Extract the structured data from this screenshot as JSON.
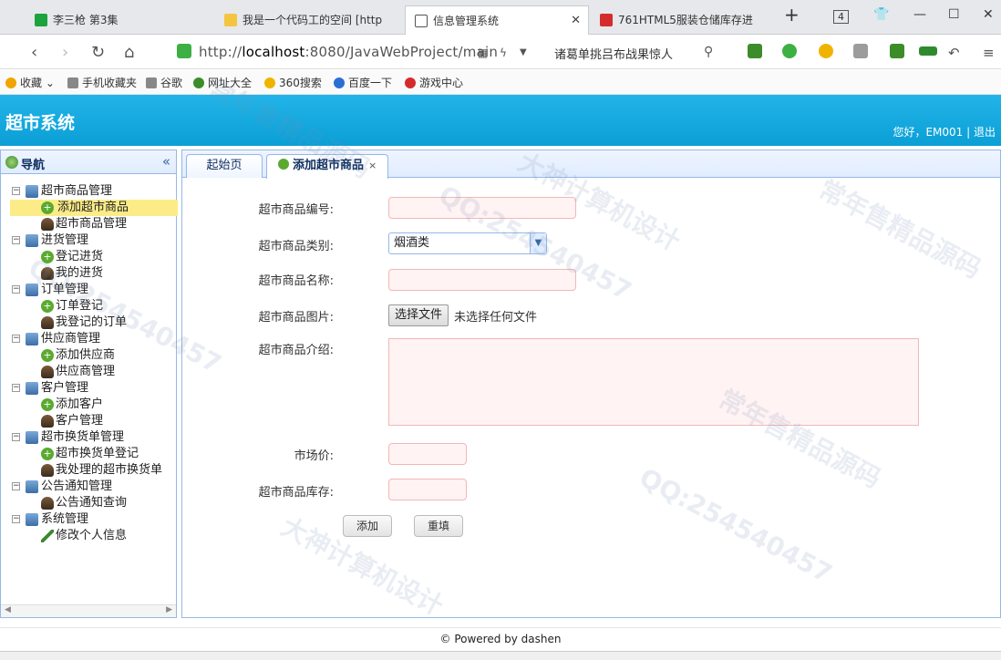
{
  "browser": {
    "tabs": [
      {
        "title": "李三枪 第3集",
        "favicon_color": "#1da33e"
      },
      {
        "title": "我是一个代码工的空间 [http",
        "favicon_color": "#f5c542"
      },
      {
        "title": "信息管理系统",
        "favicon_color": "#555555"
      },
      {
        "title": "761HTML5服装仓储库存进",
        "favicon_color": "#d42c2c"
      }
    ],
    "tab_count": "4",
    "url_prefix": "http://",
    "url_host": "localhost",
    "url_rest": ":8080/JavaWebProject/main",
    "search_text": "诸葛单挑吕布战果惊人",
    "bookmarks": [
      {
        "label": "收藏",
        "color": "#f0a500"
      },
      {
        "label": "手机收藏夹",
        "color": "#888888"
      },
      {
        "label": "谷歌",
        "color": "#888888"
      },
      {
        "label": "网址大全",
        "color": "#3c8c2a"
      },
      {
        "label": "360搜索",
        "color": "#f0b400"
      },
      {
        "label": "百度一下",
        "color": "#2b6fd6"
      },
      {
        "label": "游戏中心",
        "color": "#d42c2c"
      }
    ]
  },
  "header": {
    "title": "超市系统",
    "greeting": "您好，EM001",
    "separator": "|",
    "logout": "退出",
    "color": "#12a9e0"
  },
  "sidebar": {
    "title": "导航",
    "collapse_icon": "«",
    "tree": [
      {
        "label": "超市商品管理",
        "level": 0,
        "icon": "computer-icon"
      },
      {
        "label": "添加超市商品",
        "level": 1,
        "icon": "add-icon",
        "selected": true
      },
      {
        "label": "超市商品管理",
        "level": 1,
        "icon": "user-icon"
      },
      {
        "label": "进货管理",
        "level": 0,
        "icon": "computer-icon"
      },
      {
        "label": "登记进货",
        "level": 1,
        "icon": "add-icon"
      },
      {
        "label": "我的进货",
        "level": 1,
        "icon": "user-icon"
      },
      {
        "label": "订单管理",
        "level": 0,
        "icon": "computer-icon"
      },
      {
        "label": "订单登记",
        "level": 1,
        "icon": "add-icon"
      },
      {
        "label": "我登记的订单",
        "level": 1,
        "icon": "user-icon"
      },
      {
        "label": "供应商管理",
        "level": 0,
        "icon": "computer-icon"
      },
      {
        "label": "添加供应商",
        "level": 1,
        "icon": "add-icon"
      },
      {
        "label": "供应商管理",
        "level": 1,
        "icon": "user-icon"
      },
      {
        "label": "客户管理",
        "level": 0,
        "icon": "computer-icon"
      },
      {
        "label": "添加客户",
        "level": 1,
        "icon": "add-icon"
      },
      {
        "label": "客户管理",
        "level": 1,
        "icon": "user-icon"
      },
      {
        "label": "超市换货单管理",
        "level": 0,
        "icon": "computer-icon"
      },
      {
        "label": "超市换货单登记",
        "level": 1,
        "icon": "add-icon"
      },
      {
        "label": "我处理的超市换货单",
        "level": 1,
        "icon": "user-icon"
      },
      {
        "label": "公告通知管理",
        "level": 0,
        "icon": "computer-icon"
      },
      {
        "label": "公告通知查询",
        "level": 1,
        "icon": "user-icon"
      },
      {
        "label": "系统管理",
        "level": 0,
        "icon": "computer-icon"
      },
      {
        "label": "修改个人信息",
        "level": 1,
        "icon": "pencil-icon"
      }
    ]
  },
  "content": {
    "tabs": [
      {
        "label": "起始页"
      },
      {
        "label": "添加超市商品",
        "close": "×"
      }
    ],
    "form": {
      "code_label": "超市商品编号:",
      "category_label": "超市商品类别:",
      "category_value": "烟酒类",
      "name_label": "超市商品名称:",
      "image_label": "超市商品图片:",
      "file_button": "选择文件",
      "file_status": "未选择任何文件",
      "intro_label": "超市商品介绍:",
      "price_label": "市场价:",
      "stock_label": "超市商品库存:",
      "add_button": "添加",
      "reset_button": "重填"
    }
  },
  "footer": {
    "text": "© Powered by dashen"
  },
  "watermarks": [
    "常年售精品源码",
    "QQ:254540457",
    "大神计算机设计"
  ]
}
